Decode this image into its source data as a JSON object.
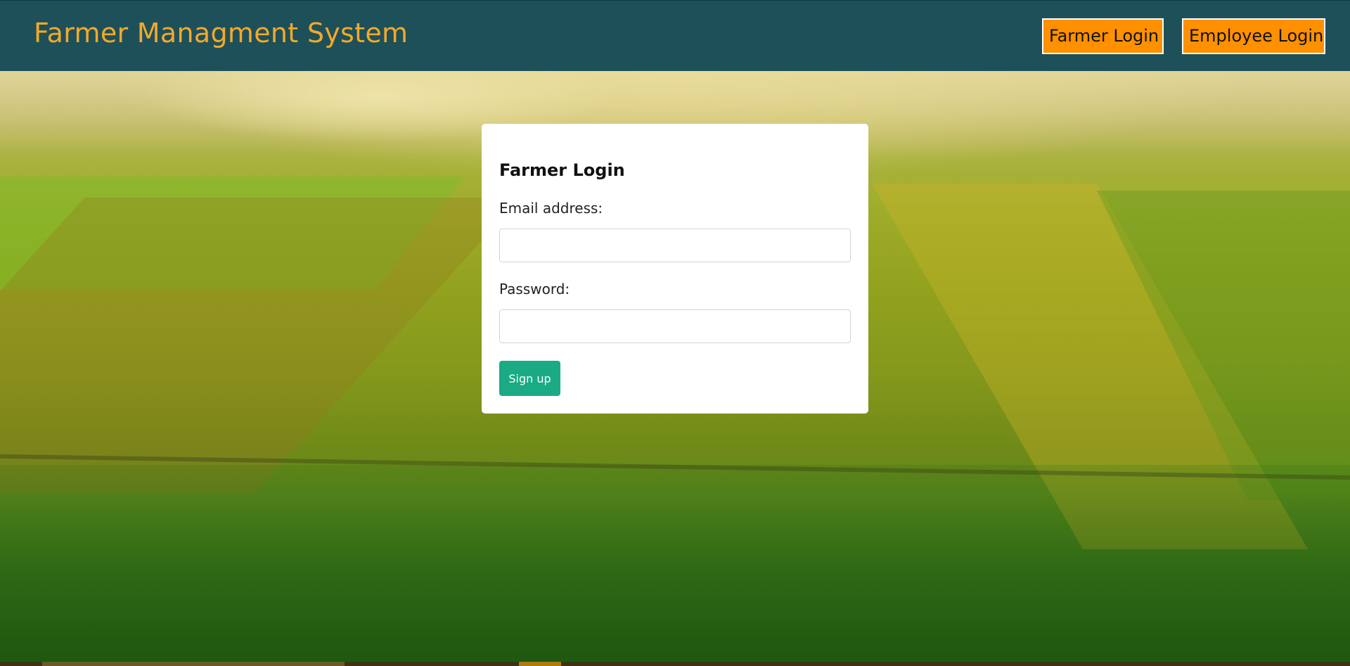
{
  "navbar": {
    "brand": "Farmer Managment System",
    "farmer_login_label": "Farmer Login",
    "employee_login_label": "Employee Login",
    "background_color": "#1e5059",
    "brand_color": "#f2a92b",
    "button_color": "#ff9000"
  },
  "login_card": {
    "title": "Farmer Login",
    "email_label": "Email address:",
    "email_value": "",
    "password_label": "Password:",
    "password_value": "",
    "submit_label": "Sign up",
    "submit_color": "#1aab84"
  },
  "hero": {
    "image": "farm-fields-aerial-photo"
  }
}
